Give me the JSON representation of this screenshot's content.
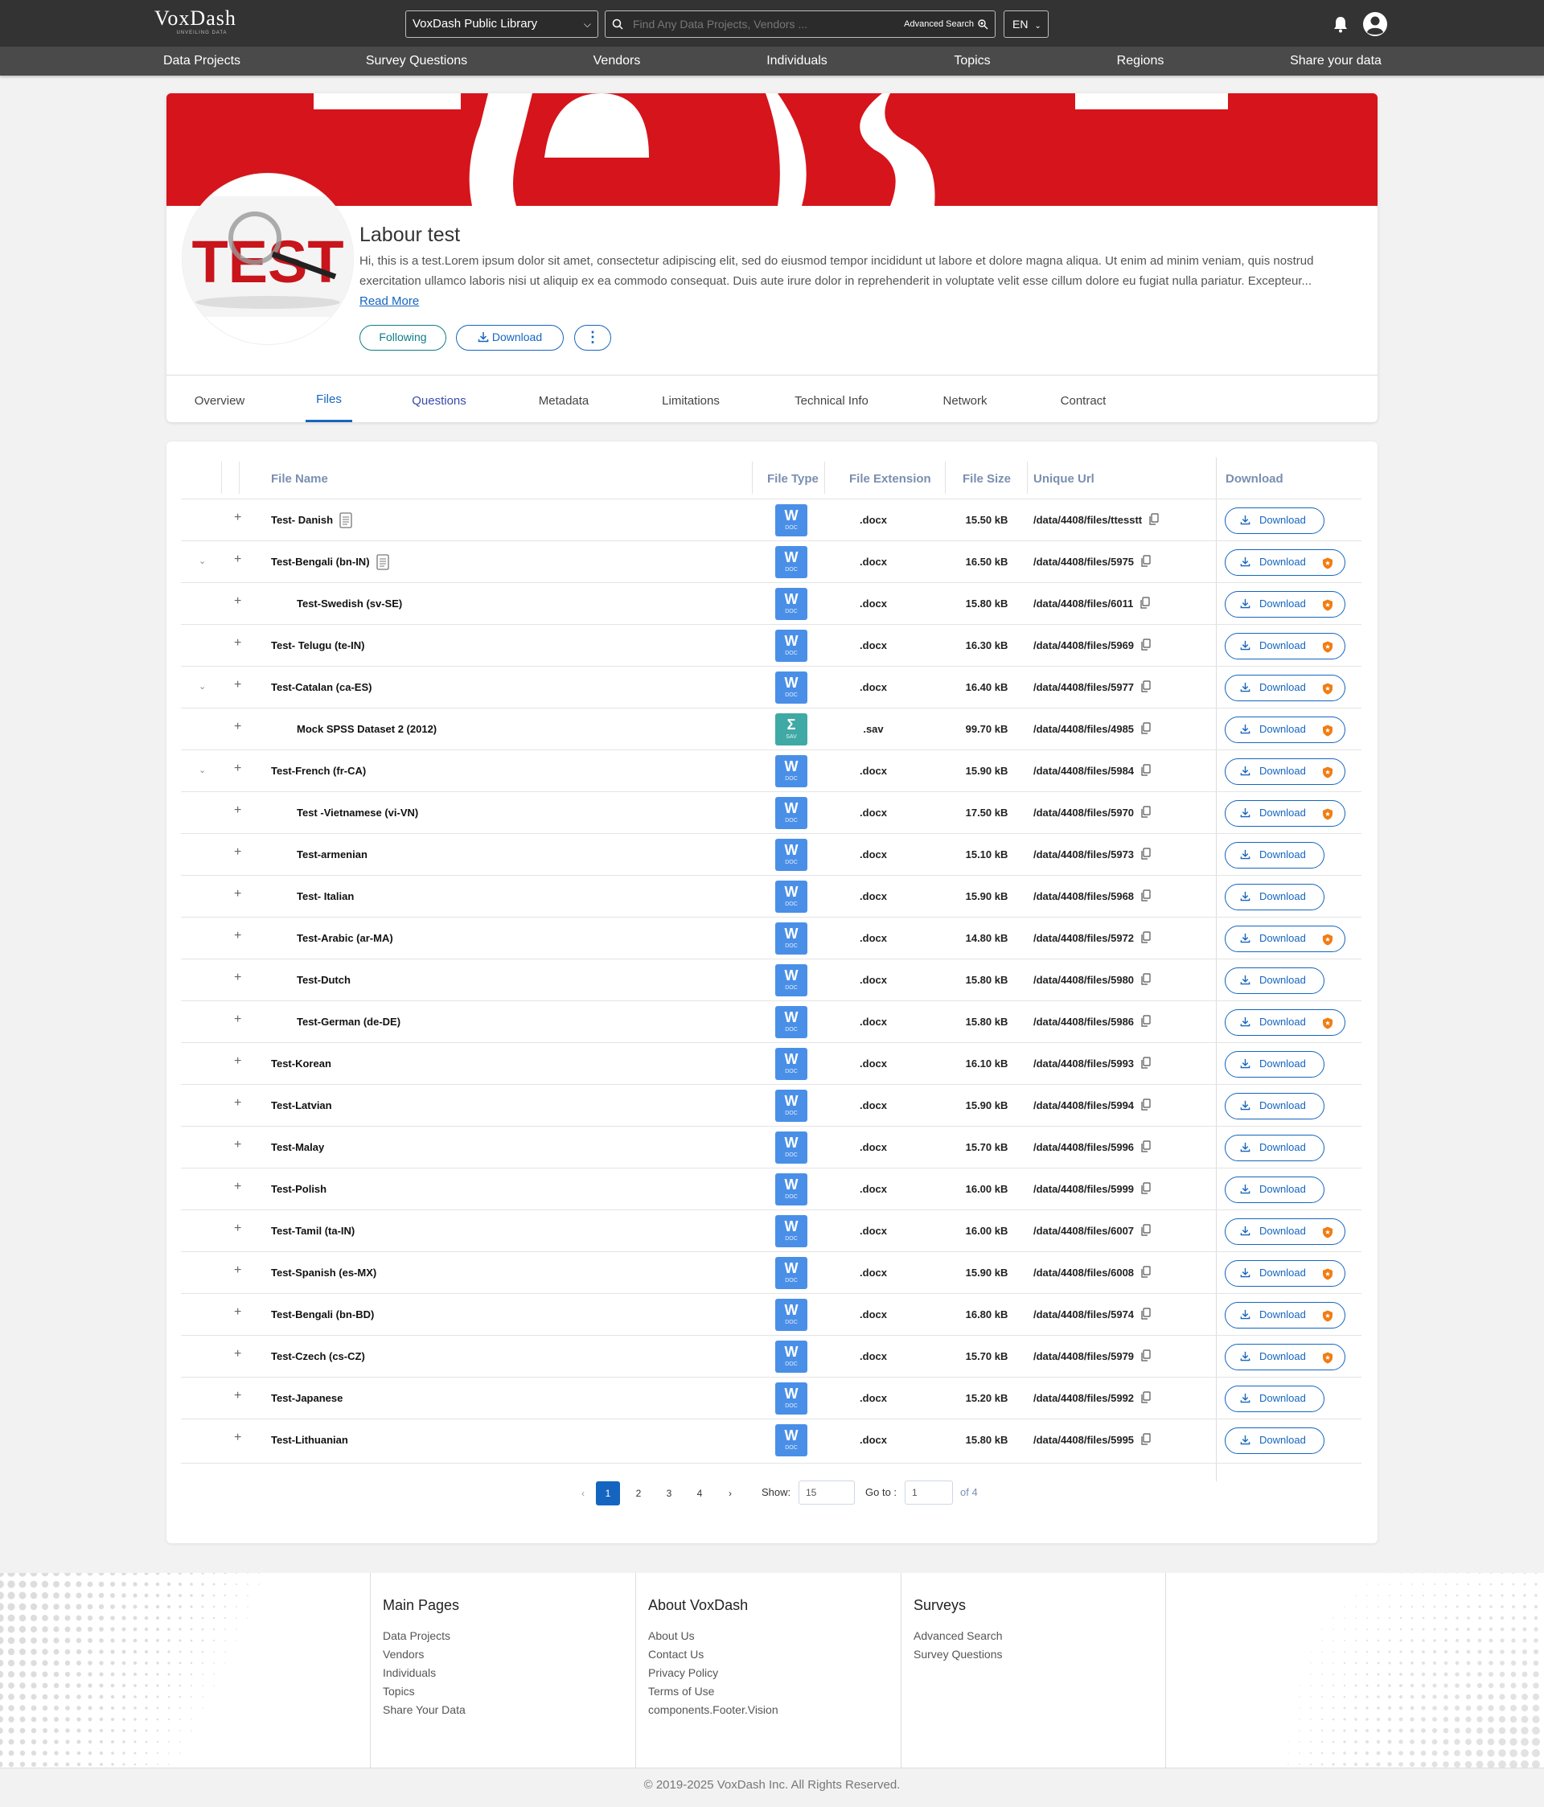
{
  "header": {
    "logo_main": "VoxDash",
    "logo_tagline": "UNVEILING DATA",
    "library_select": "VoxDash Public Library",
    "search_placeholder": "Find Any Data Projects, Vendors ...",
    "advanced_search": "Advanced Search",
    "language": "EN"
  },
  "nav": [
    "Data Projects",
    "Survey Questions",
    "Vendors",
    "Individuals",
    "Topics",
    "Regions",
    "Share your data"
  ],
  "project": {
    "title": "Labour test",
    "description": "Hi, this is a test.Lorem ipsum dolor sit amet, consectetur adipiscing elit, sed do eiusmod tempor incididunt ut labore et dolore magna aliqua. Ut enim ad minim veniam, quis nostrud exercitation ullamco laboris nisi ut aliquip ex ea commodo consequat. Duis aute irure dolor in reprehenderit in voluptate velit esse cillum dolore eu fugiat nulla pariatur. Excepteur...",
    "read_more": "Read More",
    "following": "Following",
    "download": "Download",
    "more": "⋮",
    "avatar_text": "TEST"
  },
  "tabs": [
    "Overview",
    "Files",
    "Questions",
    "Metadata",
    "Limitations",
    "Technical Info",
    "Network",
    "Contract"
  ],
  "active_tab": "Files",
  "table": {
    "headers": {
      "file_name": "File Name",
      "file_type": "File Type",
      "file_extension": "File Extension",
      "file_size": "File Size",
      "unique_url": "Unique Url",
      "download": "Download"
    },
    "rows": [
      {
        "name": "Test- Danish",
        "indent": 0,
        "expand": false,
        "doc_icon": true,
        "type": "W",
        "type_sub": "DOC",
        "ext": ".docx",
        "size": "15.50 kB",
        "url": "/data/4408/files/ttesstt",
        "premium": false
      },
      {
        "name": "Test-Bengali (bn-IN)",
        "indent": 0,
        "expand": true,
        "doc_icon": true,
        "type": "W",
        "type_sub": "DOC",
        "ext": ".docx",
        "size": "16.50 kB",
        "url": "/data/4408/files/5975",
        "premium": true
      },
      {
        "name": "Test-Swedish (sv-SE)",
        "indent": 1,
        "expand": false,
        "doc_icon": false,
        "type": "W",
        "type_sub": "DOC",
        "ext": ".docx",
        "size": "15.80 kB",
        "url": "/data/4408/files/6011",
        "premium": true
      },
      {
        "name": "Test- Telugu (te-IN)",
        "indent": 0,
        "expand": false,
        "doc_icon": false,
        "type": "W",
        "type_sub": "DOC",
        "ext": ".docx",
        "size": "16.30 kB",
        "url": "/data/4408/files/5969",
        "premium": true
      },
      {
        "name": "Test-Catalan (ca-ES)",
        "indent": 0,
        "expand": true,
        "doc_icon": false,
        "type": "W",
        "type_sub": "DOC",
        "ext": ".docx",
        "size": "16.40 kB",
        "url": "/data/4408/files/5977",
        "premium": true
      },
      {
        "name": "Mock SPSS Dataset 2 (2012)",
        "indent": 1,
        "expand": false,
        "doc_icon": false,
        "type": "Σ",
        "type_sub": "SAV",
        "ext": ".sav",
        "size": "99.70 kB",
        "url": "/data/4408/files/4985",
        "premium": true
      },
      {
        "name": "Test-French (fr-CA)",
        "indent": 0,
        "expand": true,
        "doc_icon": false,
        "type": "W",
        "type_sub": "DOC",
        "ext": ".docx",
        "size": "15.90 kB",
        "url": "/data/4408/files/5984",
        "premium": true
      },
      {
        "name": "Test -Vietnamese (vi-VN)",
        "indent": 1,
        "expand": false,
        "doc_icon": false,
        "type": "W",
        "type_sub": "DOC",
        "ext": ".docx",
        "size": "17.50 kB",
        "url": "/data/4408/files/5970",
        "premium": true
      },
      {
        "name": "Test-armenian",
        "indent": 1,
        "expand": false,
        "doc_icon": false,
        "type": "W",
        "type_sub": "DOC",
        "ext": ".docx",
        "size": "15.10 kB",
        "url": "/data/4408/files/5973",
        "premium": false
      },
      {
        "name": "Test- Italian",
        "indent": 1,
        "expand": false,
        "doc_icon": false,
        "type": "W",
        "type_sub": "DOC",
        "ext": ".docx",
        "size": "15.90 kB",
        "url": "/data/4408/files/5968",
        "premium": false
      },
      {
        "name": "Test-Arabic (ar-MA)",
        "indent": 1,
        "expand": false,
        "doc_icon": false,
        "type": "W",
        "type_sub": "DOC",
        "ext": ".docx",
        "size": "14.80 kB",
        "url": "/data/4408/files/5972",
        "premium": true
      },
      {
        "name": "Test-Dutch",
        "indent": 1,
        "expand": false,
        "doc_icon": false,
        "type": "W",
        "type_sub": "DOC",
        "ext": ".docx",
        "size": "15.80 kB",
        "url": "/data/4408/files/5980",
        "premium": false
      },
      {
        "name": "Test-German (de-DE)",
        "indent": 1,
        "expand": false,
        "doc_icon": false,
        "type": "W",
        "type_sub": "DOC",
        "ext": ".docx",
        "size": "15.80 kB",
        "url": "/data/4408/files/5986",
        "premium": true
      },
      {
        "name": "Test-Korean",
        "indent": 0,
        "expand": false,
        "doc_icon": false,
        "type": "W",
        "type_sub": "DOC",
        "ext": ".docx",
        "size": "16.10 kB",
        "url": "/data/4408/files/5993",
        "premium": false
      },
      {
        "name": "Test-Latvian",
        "indent": 0,
        "expand": false,
        "doc_icon": false,
        "type": "W",
        "type_sub": "DOC",
        "ext": ".docx",
        "size": "15.90 kB",
        "url": "/data/4408/files/5994",
        "premium": false
      },
      {
        "name": "Test-Malay",
        "indent": 0,
        "expand": false,
        "doc_icon": false,
        "type": "W",
        "type_sub": "DOC",
        "ext": ".docx",
        "size": "15.70 kB",
        "url": "/data/4408/files/5996",
        "premium": false
      },
      {
        "name": "Test-Polish",
        "indent": 0,
        "expand": false,
        "doc_icon": false,
        "type": "W",
        "type_sub": "DOC",
        "ext": ".docx",
        "size": "16.00 kB",
        "url": "/data/4408/files/5999",
        "premium": false
      },
      {
        "name": "Test-Tamil (ta-IN)",
        "indent": 0,
        "expand": false,
        "doc_icon": false,
        "type": "W",
        "type_sub": "DOC",
        "ext": ".docx",
        "size": "16.00 kB",
        "url": "/data/4408/files/6007",
        "premium": true
      },
      {
        "name": "Test-Spanish (es-MX)",
        "indent": 0,
        "expand": false,
        "doc_icon": false,
        "type": "W",
        "type_sub": "DOC",
        "ext": ".docx",
        "size": "15.90 kB",
        "url": "/data/4408/files/6008",
        "premium": true
      },
      {
        "name": "Test-Bengali (bn-BD)",
        "indent": 0,
        "expand": false,
        "doc_icon": false,
        "type": "W",
        "type_sub": "DOC",
        "ext": ".docx",
        "size": "16.80 kB",
        "url": "/data/4408/files/5974",
        "premium": true
      },
      {
        "name": "Test-Czech (cs-CZ)",
        "indent": 0,
        "expand": false,
        "doc_icon": false,
        "type": "W",
        "type_sub": "DOC",
        "ext": ".docx",
        "size": "15.70 kB",
        "url": "/data/4408/files/5979",
        "premium": true
      },
      {
        "name": "Test-Japanese",
        "indent": 0,
        "expand": false,
        "doc_icon": false,
        "type": "W",
        "type_sub": "DOC",
        "ext": ".docx",
        "size": "15.20 kB",
        "url": "/data/4408/files/5992",
        "premium": false
      },
      {
        "name": "Test-Lithuanian",
        "indent": 0,
        "expand": false,
        "doc_icon": false,
        "type": "W",
        "type_sub": "DOC",
        "ext": ".docx",
        "size": "15.80 kB",
        "url": "/data/4408/files/5995",
        "premium": false
      }
    ],
    "download_label": "Download"
  },
  "pagination": {
    "prev": "‹",
    "pages": [
      "1",
      "2",
      "3",
      "4"
    ],
    "current": "1",
    "next": "›",
    "show_label": "Show:",
    "show_value": "15",
    "goto_label": "Go to :",
    "goto_value": "1",
    "of_label": "of 4"
  },
  "footer": {
    "columns": [
      {
        "title": "Main Pages",
        "links": [
          "Data Projects",
          "Vendors",
          "Individuals",
          "Topics",
          "Share Your Data"
        ]
      },
      {
        "title": "About VoxDash",
        "links": [
          "About Us",
          "Contact Us",
          "Privacy Policy",
          "Terms of Use",
          "components.Footer.Vision"
        ]
      },
      {
        "title": "Surveys",
        "links": [
          "Advanced Search",
          "Survey Questions"
        ]
      }
    ],
    "copyright": "© 2019-2025 VoxDash Inc. All Rights Reserved."
  },
  "colors": {
    "accent": "#1565c0",
    "brand_red": "#d6141b",
    "doc_blue": "#4a8fe7",
    "sav_teal": "#3fa9a5",
    "premium_orange": "#f07d14",
    "teal": "#0e7c86"
  }
}
